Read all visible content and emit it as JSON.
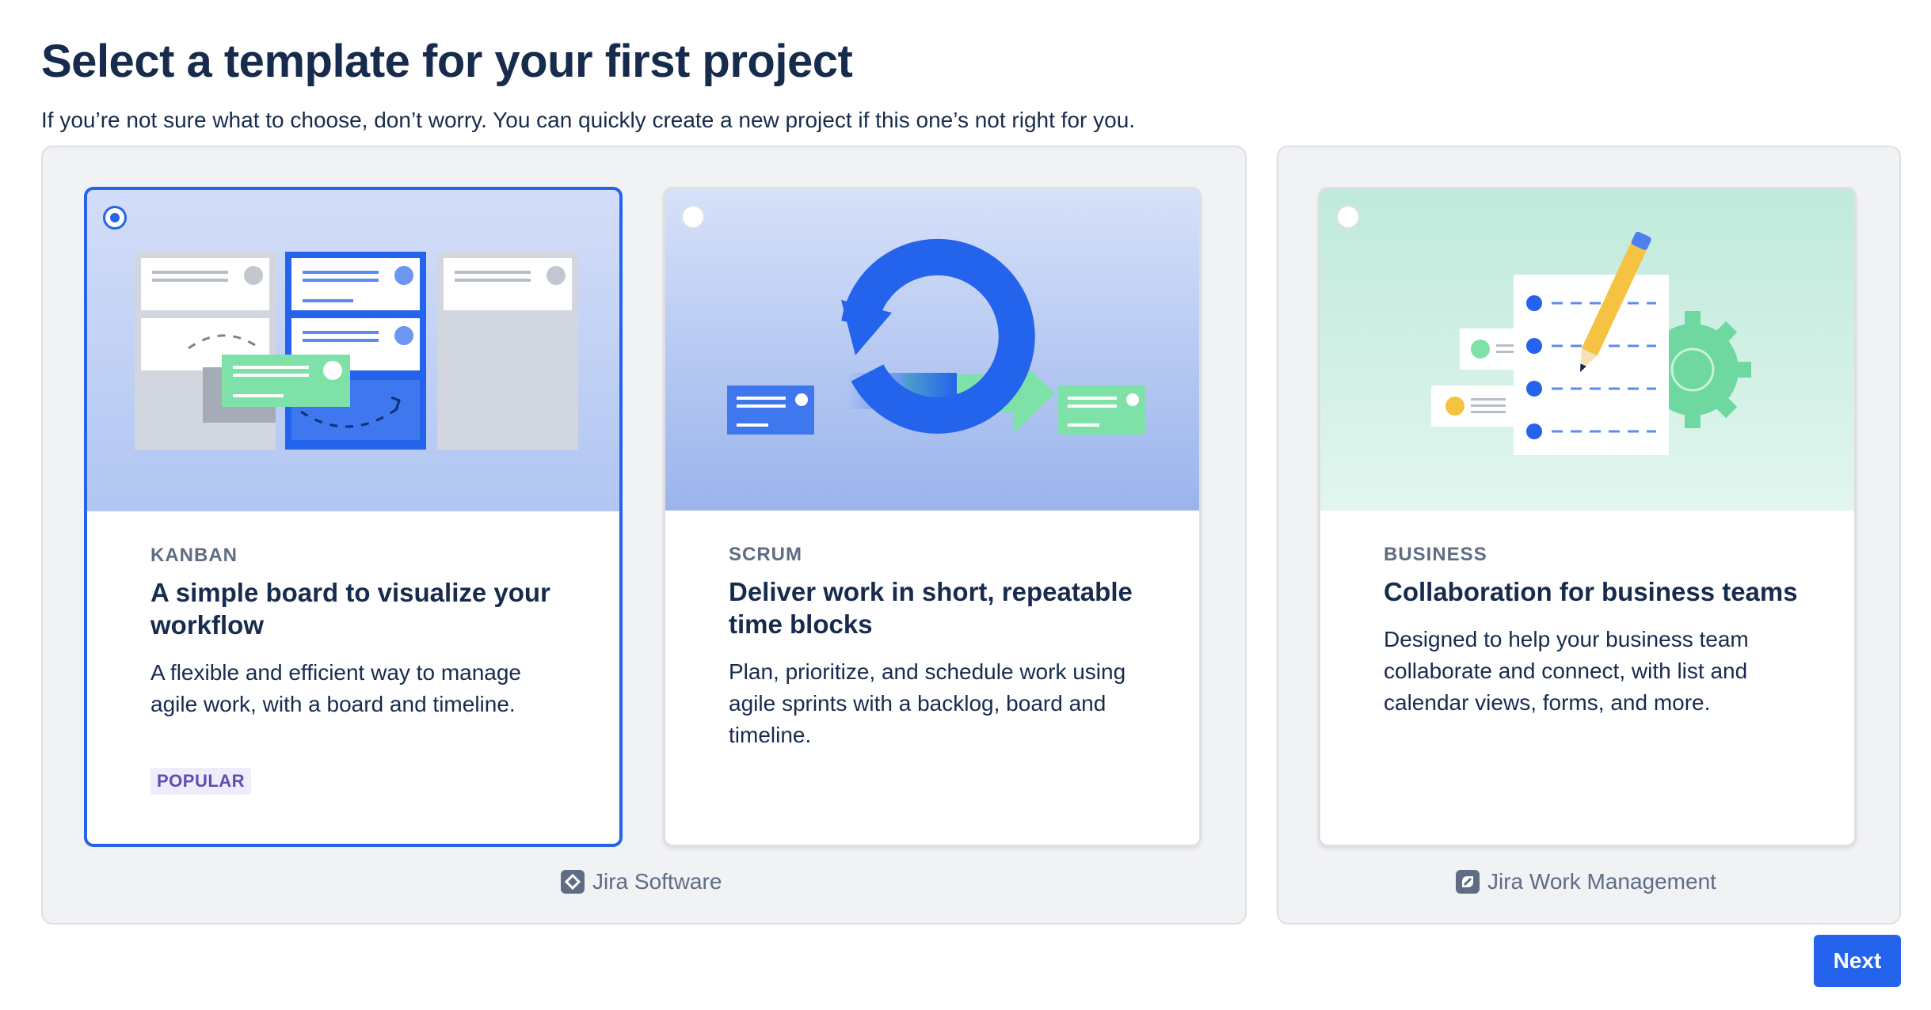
{
  "header": {
    "title": "Select a template for your first project",
    "subtitle": "If you’re not sure what to choose, don’t worry. You can quickly create a new project if this one’s not right for you."
  },
  "groups": [
    {
      "product_label": "Jira Software",
      "product_icon": "jira-software-icon",
      "cards": [
        {
          "kind": "KANBAN",
          "heading": "A simple board to visualize your workflow",
          "description": "A flexible and efficient way to manage agile work, with a board and timeline.",
          "badge": "POPULAR",
          "selected": true,
          "illustration": "kanban-board-illustration"
        },
        {
          "kind": "SCRUM",
          "heading": "Deliver work in short, repeatable time blocks",
          "description": "Plan, prioritize, and schedule work using agile sprints with a backlog, board and timeline.",
          "selected": false,
          "illustration": "scrum-sprint-cycle-illustration"
        }
      ]
    },
    {
      "product_label": "Jira Work Management",
      "product_icon": "jira-work-management-icon",
      "cards": [
        {
          "kind": "BUSINESS",
          "heading": "Collaboration for business teams",
          "description": "Designed to help your business team collaborate and connect, with list and calendar views, forms, and more.",
          "selected": false,
          "illustration": "business-checklist-illustration"
        }
      ]
    }
  ],
  "footer": {
    "next_label": "Next"
  },
  "colors": {
    "accent": "#2463eb",
    "heading": "#172b4d",
    "muted": "#5e6c84",
    "panel_bg": "#f1f2f4",
    "badge_bg": "#f0ecfb",
    "badge_text": "#5e4db2",
    "green": "#7ee2a8"
  }
}
